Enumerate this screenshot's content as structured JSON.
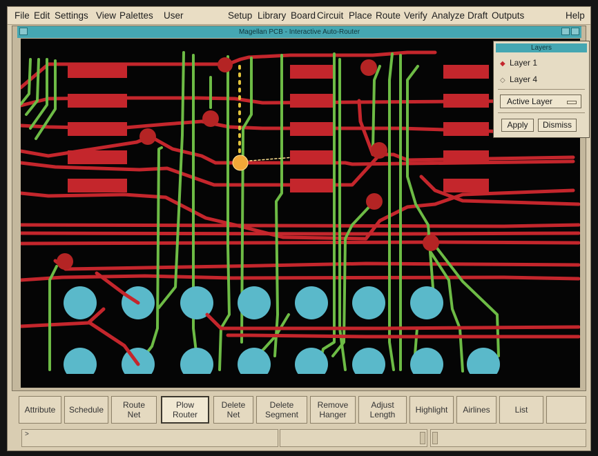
{
  "menu": {
    "left": [
      "File",
      "Edit",
      "Settings",
      "View",
      "Palettes",
      "User"
    ],
    "right": [
      "Setup",
      "Library",
      "Board",
      "Circuit",
      "Place",
      "Route",
      "Verify",
      "Analyze",
      "Draft",
      "Outputs"
    ],
    "help": "Help"
  },
  "window": {
    "title": "Magellan PCB - Interactive Auto-Router"
  },
  "layers_dialog": {
    "title": "Layers",
    "layers": [
      {
        "label": "Layer 1",
        "selected": true
      },
      {
        "label": "Layer 4",
        "selected": false
      }
    ],
    "option_menu": "Active Layer",
    "apply": "Apply",
    "dismiss": "Dismiss"
  },
  "toolbar": {
    "attribute": "Attribute",
    "schedule": "Schedule",
    "route_net": "Route\nNet",
    "plow_router": "Plow\nRouter",
    "delete_net": "Delete\nNet",
    "delete_segment": "Delete\nSegment",
    "remove_hanger": "Remove\nHanger",
    "adjust_length": "Adjust\nLength",
    "highlight": "Highlight",
    "airlines": "Airlines",
    "list": "List",
    "active": "plow_router"
  },
  "status": {
    "prompt": ">"
  },
  "colors": {
    "layer1_trace": "#c4262c",
    "layer4_trace": "#6dbb45",
    "pad": "#5ab9ca",
    "via": "#b42424",
    "cursor_via": "#f2a838",
    "background": "#050505",
    "accent_title": "#45a7b2"
  }
}
